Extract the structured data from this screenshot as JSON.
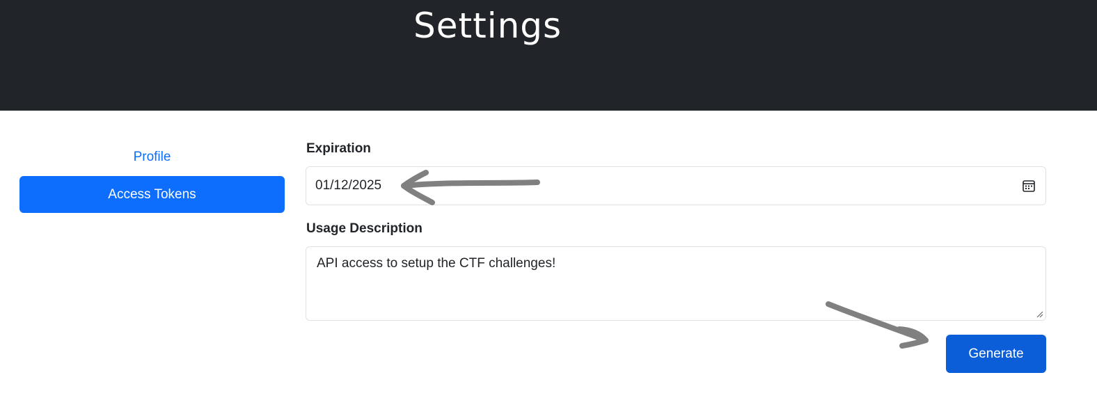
{
  "header": {
    "title": "Settings"
  },
  "sidebar": {
    "items": [
      {
        "label": "Profile",
        "active": false
      },
      {
        "label": "Access Tokens",
        "active": true
      }
    ]
  },
  "form": {
    "expiration_label": "Expiration",
    "expiration_value": "01/12/2025",
    "description_label": "Usage Description",
    "description_value": "API access to setup the CTF challenges!",
    "generate_label": "Generate"
  },
  "icons": {
    "calendar": "calendar-icon",
    "resize": "resize-handle-icon"
  },
  "colors": {
    "header_bg": "#212529",
    "primary": "#0d6efd",
    "button": "#0b5ed7",
    "annotation": "#808080"
  }
}
